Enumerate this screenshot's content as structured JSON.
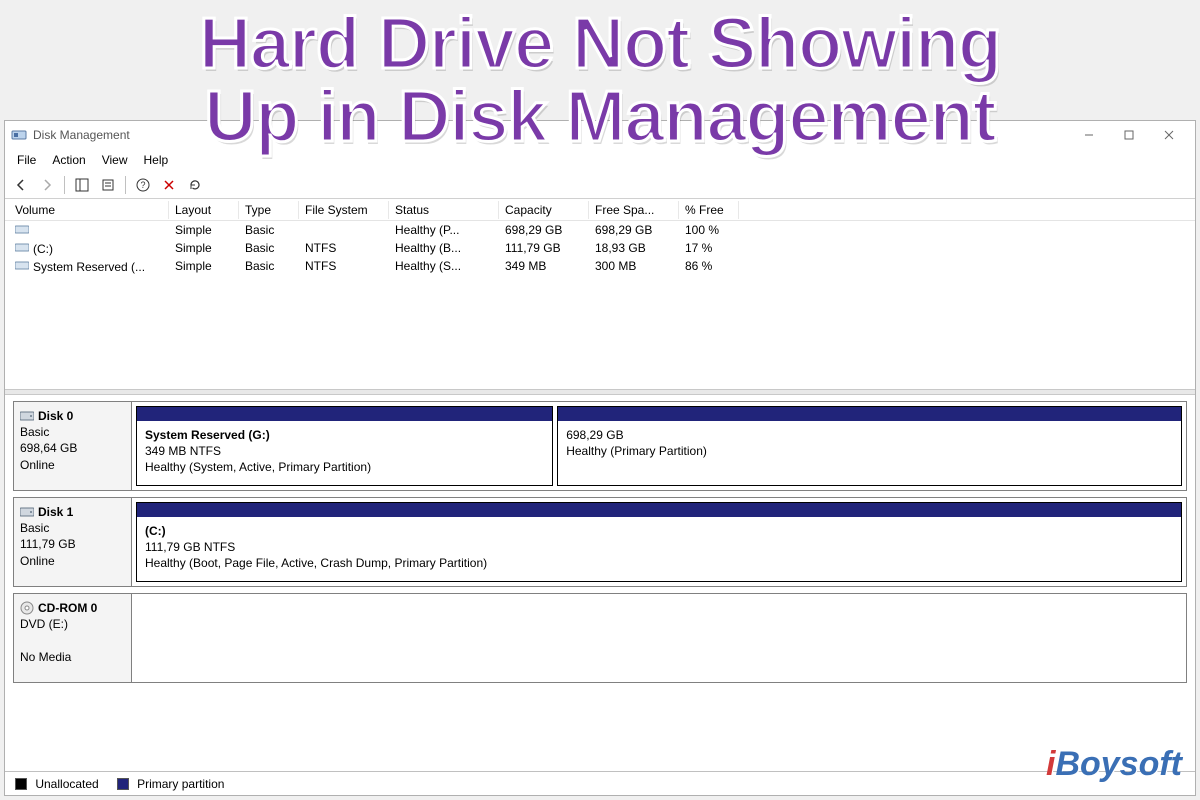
{
  "overlay": {
    "line1": "Hard Drive Not Showing",
    "line2": "Up in Disk Management"
  },
  "brand": {
    "text_i": "i",
    "text_rest": "Boysoft"
  },
  "window": {
    "title": "Disk Management",
    "menubar": {
      "file": "File",
      "action": "Action",
      "view": "View",
      "help": "Help"
    }
  },
  "volume_table": {
    "headers": {
      "volume": "Volume",
      "layout": "Layout",
      "type": "Type",
      "fs": "File System",
      "status": "Status",
      "capacity": "Capacity",
      "free": "Free Spa...",
      "pct": "% Free"
    },
    "rows": [
      {
        "volume": "",
        "layout": "Simple",
        "type": "Basic",
        "fs": "",
        "status": "Healthy (P...",
        "capacity": "698,29 GB",
        "free": "698,29 GB",
        "pct": "100 %"
      },
      {
        "volume": "(C:)",
        "layout": "Simple",
        "type": "Basic",
        "fs": "NTFS",
        "status": "Healthy (B...",
        "capacity": "111,79 GB",
        "free": "18,93 GB",
        "pct": "17 %"
      },
      {
        "volume": "System Reserved (...",
        "layout": "Simple",
        "type": "Basic",
        "fs": "NTFS",
        "status": "Healthy (S...",
        "capacity": "349 MB",
        "free": "300 MB",
        "pct": "86 %"
      }
    ]
  },
  "disks": [
    {
      "name": "Disk 0",
      "kind": "Basic",
      "size": "698,64 GB",
      "state": "Online",
      "partitions": [
        {
          "title": "System Reserved  (G:)",
          "sub": "349 MB NTFS",
          "status": "Healthy (System, Active, Primary Partition)",
          "flex": 40
        },
        {
          "title": "",
          "sub": "698,29 GB",
          "status": "Healthy (Primary Partition)",
          "flex": 60
        }
      ]
    },
    {
      "name": "Disk 1",
      "kind": "Basic",
      "size": "111,79 GB",
      "state": "Online",
      "partitions": [
        {
          "title": "(C:)",
          "sub": "111,79 GB NTFS",
          "status": "Healthy (Boot, Page File, Active, Crash Dump, Primary Partition)",
          "flex": 100
        }
      ]
    },
    {
      "name": "CD-ROM 0",
      "kind": "DVD (E:)",
      "size": "",
      "state": "No Media",
      "partitions": []
    }
  ],
  "legend": {
    "unallocated": "Unallocated",
    "primary": "Primary partition"
  },
  "colors": {
    "stripe": "#21247a",
    "overlay": "#7a3aa8"
  }
}
